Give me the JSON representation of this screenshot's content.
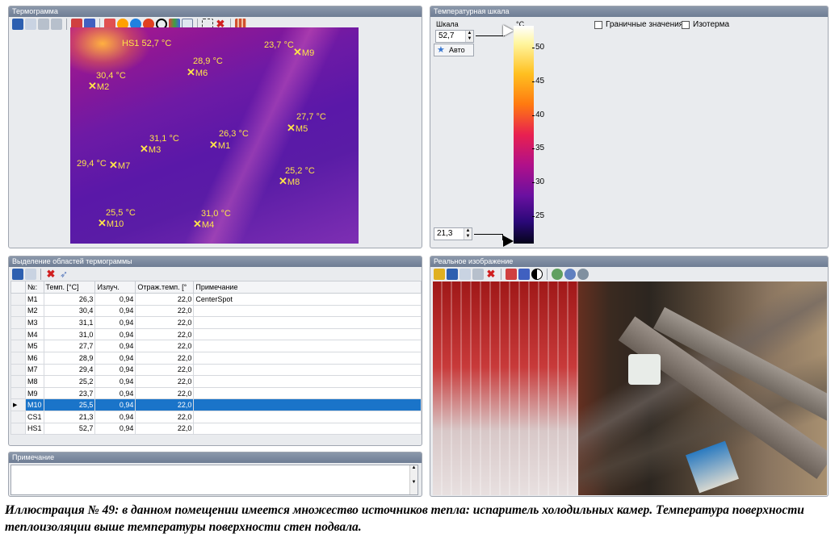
{
  "thermogram": {
    "title": "Термограмма",
    "hotspot_label": "HS1 52,7 °C",
    "markers": [
      {
        "id": "M9",
        "temp": "23,7 °C"
      },
      {
        "id": "M6",
        "temp": "28,9 °C"
      },
      {
        "id": "M2",
        "temp": "30,4 °C"
      },
      {
        "id": "M5",
        "temp": "27,7 °C"
      },
      {
        "id": "M3",
        "temp": "31,1 °C"
      },
      {
        "id": "M1",
        "temp": "26,3 °C"
      },
      {
        "id": "M7",
        "temp": "29,4 °C"
      },
      {
        "id": "M8",
        "temp": "25,2 °C"
      },
      {
        "id": "M10",
        "temp": "25,5 °C"
      },
      {
        "id": "M4",
        "temp": "31,0 °C"
      }
    ]
  },
  "scale": {
    "title": "Температурная шкала",
    "label": "Шкала",
    "max": "52,7",
    "min": "21,3",
    "auto_label": "Авто",
    "unit": "°C",
    "ticks": [
      "50",
      "45",
      "40",
      "35",
      "30",
      "25"
    ],
    "boundary_label": "Граничные значения",
    "isotherm_label": "Изотерма"
  },
  "regions": {
    "title": "Выделение областей термограммы",
    "columns": [
      "№:",
      "Темп. [°C]",
      "Излуч.",
      "Отраж.темп. [°",
      "Примечание"
    ],
    "rows": [
      [
        "M1",
        "26,3",
        "0,94",
        "22,0",
        "CenterSpot"
      ],
      [
        "M2",
        "30,4",
        "0,94",
        "22,0",
        ""
      ],
      [
        "M3",
        "31,1",
        "0,94",
        "22,0",
        ""
      ],
      [
        "M4",
        "31,0",
        "0,94",
        "22,0",
        ""
      ],
      [
        "M5",
        "27,7",
        "0,94",
        "22,0",
        ""
      ],
      [
        "M6",
        "28,9",
        "0,94",
        "22,0",
        ""
      ],
      [
        "M7",
        "29,4",
        "0,94",
        "22,0",
        ""
      ],
      [
        "M8",
        "25,2",
        "0,94",
        "22,0",
        ""
      ],
      [
        "M9",
        "23,7",
        "0,94",
        "22,0",
        ""
      ],
      [
        "M10",
        "25,5",
        "0,94",
        "22,0",
        ""
      ],
      [
        "CS1",
        "21,3",
        "0,94",
        "22,0",
        ""
      ],
      [
        "HS1",
        "52,7",
        "0,94",
        "22,0",
        ""
      ]
    ],
    "selected_row": "M10"
  },
  "note": {
    "title": "Примечание"
  },
  "real_image": {
    "title": "Реальное изображение"
  },
  "caption": {
    "prefix": "Иллюстрация № 49:",
    "text": " в данном помещении имеется множество источников тепла: испаритель холодильных камер. Температура поверхности теплоизоляции выше температуры поверхности стен подвала."
  },
  "colors": {
    "marker": "#ffe44a",
    "selection": "#1a74c9",
    "panel_title": "#7a889d"
  }
}
